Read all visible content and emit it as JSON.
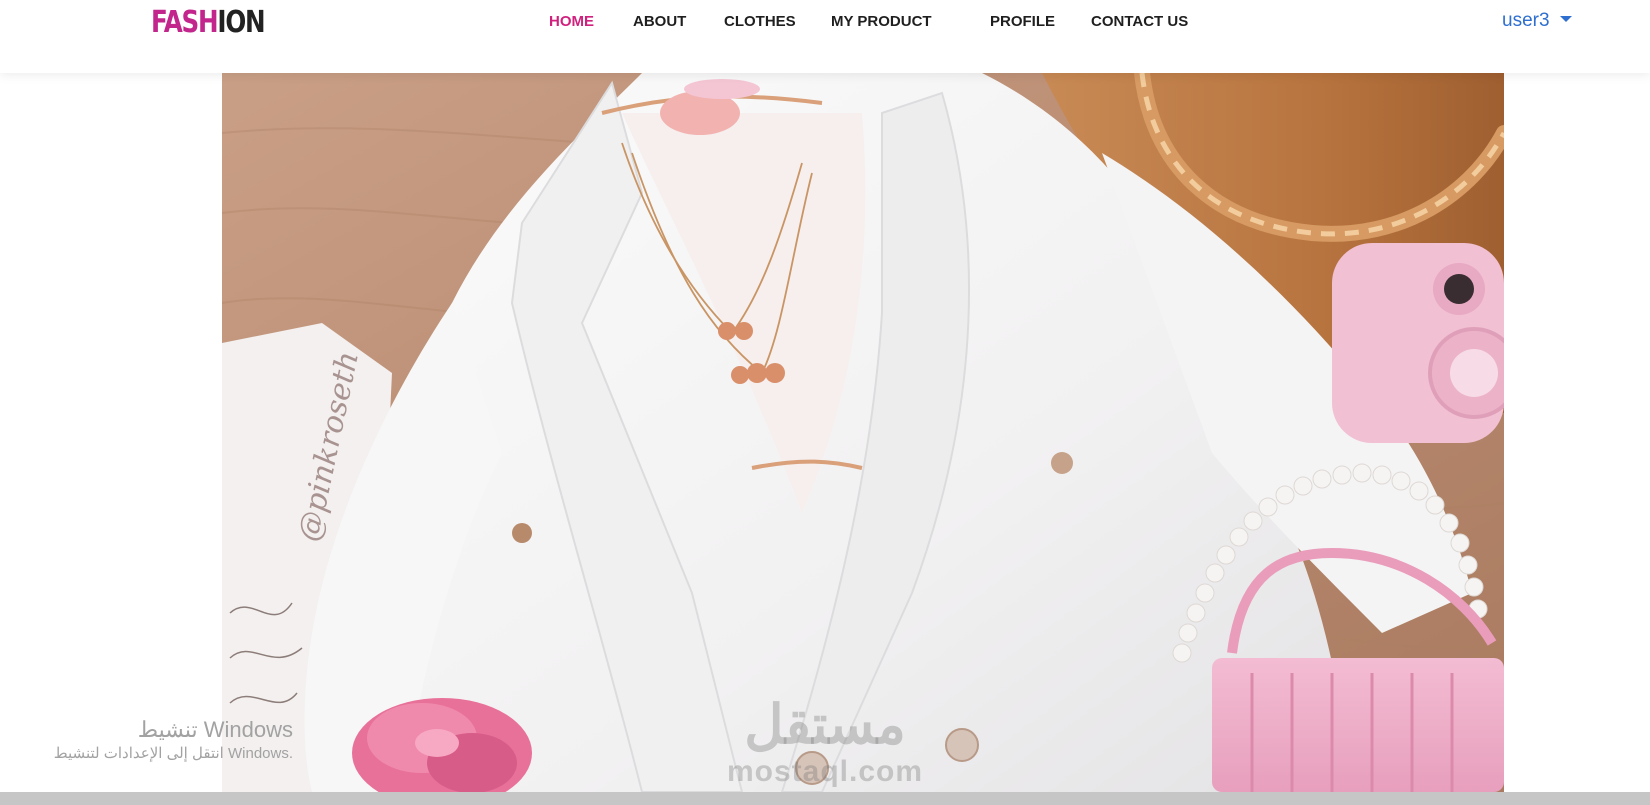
{
  "brand": {
    "part1": "FASH",
    "part2": "ION"
  },
  "nav": {
    "items": [
      {
        "label": "HOME",
        "active": true
      },
      {
        "label": "ABOUT",
        "active": false
      },
      {
        "label": "CLOTHES",
        "active": false
      },
      {
        "label": "MY PRODUCT",
        "active": false
      },
      {
        "label": "PROFILE",
        "active": false
      },
      {
        "label": "CONTACT US",
        "active": false
      }
    ]
  },
  "user": {
    "name": "user3",
    "menu_icon": "caret-down-icon"
  },
  "hero": {
    "watermark_text": "@pinkroseth"
  },
  "windows_activation": {
    "line1": "تنشيط Windows",
    "line2": "انتقل إلى الإعدادات لتنشيط Windows."
  },
  "site_watermark": {
    "arabic": "مستقل",
    "latin": "mostaql.com"
  },
  "colors": {
    "brand_pink": "#c2258c",
    "nav_active": "#d0217e",
    "nav_text": "#1f1f1f",
    "user_link": "#2f6fcf"
  }
}
